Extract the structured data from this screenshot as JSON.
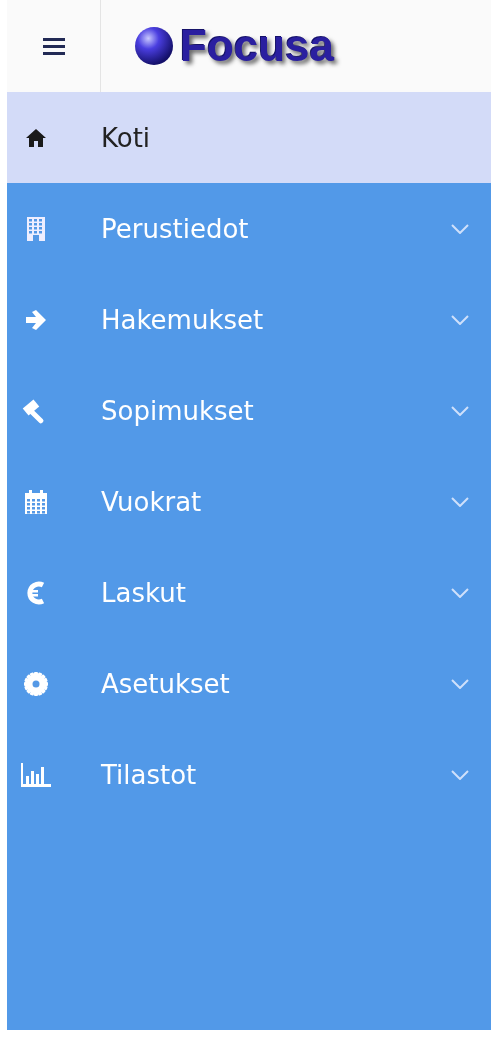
{
  "header": {
    "logo": "Focusa"
  },
  "menu": [
    {
      "label": "Koti",
      "selected": true
    },
    {
      "label": "Perustiedot",
      "selected": false,
      "expanded": false
    },
    {
      "label": "Hakemukset",
      "selected": false,
      "expanded": false
    },
    {
      "label": "Sopimukset",
      "selected": false,
      "expanded": false
    },
    {
      "label": "Vuokrat",
      "selected": false,
      "expanded": false
    },
    {
      "label": "Laskut",
      "selected": false,
      "expanded": false
    },
    {
      "label": "Asetukset",
      "selected": false,
      "expanded": false
    },
    {
      "label": "Tilastot",
      "selected": false,
      "expanded": false
    }
  ]
}
